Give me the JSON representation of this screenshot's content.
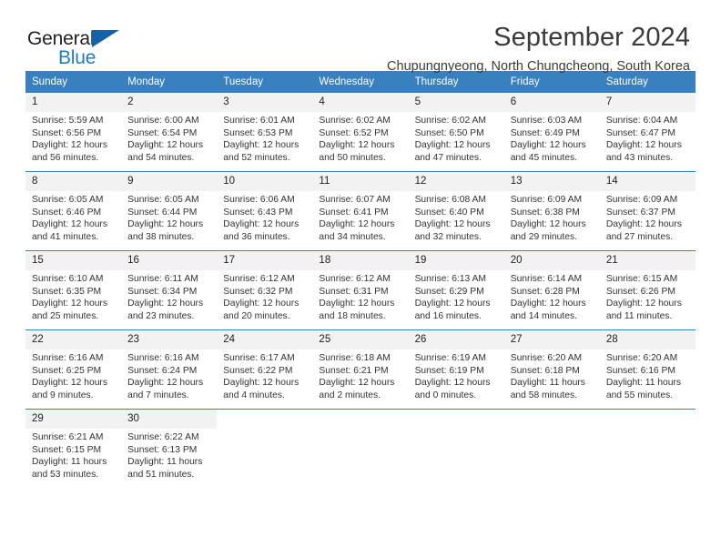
{
  "brand": {
    "name_part1": "General",
    "name_part2": "Blue",
    "triangle_color": "#1463a8",
    "blue_color": "#1f7ac4"
  },
  "header": {
    "title": "September 2024",
    "subtitle": "Chupungnyeong, North Chungcheong, South Korea"
  },
  "theme": {
    "header_bg": "#3980bf",
    "day_band_bg": "#f2f2f2",
    "row_border": "#3980bf"
  },
  "weekdays": [
    "Sunday",
    "Monday",
    "Tuesday",
    "Wednesday",
    "Thursday",
    "Friday",
    "Saturday"
  ],
  "weeks": [
    [
      {
        "day": "1",
        "sunrise": "Sunrise: 5:59 AM",
        "sunset": "Sunset: 6:56 PM",
        "daylight1": "Daylight: 12 hours",
        "daylight2": "and 56 minutes."
      },
      {
        "day": "2",
        "sunrise": "Sunrise: 6:00 AM",
        "sunset": "Sunset: 6:54 PM",
        "daylight1": "Daylight: 12 hours",
        "daylight2": "and 54 minutes."
      },
      {
        "day": "3",
        "sunrise": "Sunrise: 6:01 AM",
        "sunset": "Sunset: 6:53 PM",
        "daylight1": "Daylight: 12 hours",
        "daylight2": "and 52 minutes."
      },
      {
        "day": "4",
        "sunrise": "Sunrise: 6:02 AM",
        "sunset": "Sunset: 6:52 PM",
        "daylight1": "Daylight: 12 hours",
        "daylight2": "and 50 minutes."
      },
      {
        "day": "5",
        "sunrise": "Sunrise: 6:02 AM",
        "sunset": "Sunset: 6:50 PM",
        "daylight1": "Daylight: 12 hours",
        "daylight2": "and 47 minutes."
      },
      {
        "day": "6",
        "sunrise": "Sunrise: 6:03 AM",
        "sunset": "Sunset: 6:49 PM",
        "daylight1": "Daylight: 12 hours",
        "daylight2": "and 45 minutes."
      },
      {
        "day": "7",
        "sunrise": "Sunrise: 6:04 AM",
        "sunset": "Sunset: 6:47 PM",
        "daylight1": "Daylight: 12 hours",
        "daylight2": "and 43 minutes."
      }
    ],
    [
      {
        "day": "8",
        "sunrise": "Sunrise: 6:05 AM",
        "sunset": "Sunset: 6:46 PM",
        "daylight1": "Daylight: 12 hours",
        "daylight2": "and 41 minutes."
      },
      {
        "day": "9",
        "sunrise": "Sunrise: 6:05 AM",
        "sunset": "Sunset: 6:44 PM",
        "daylight1": "Daylight: 12 hours",
        "daylight2": "and 38 minutes."
      },
      {
        "day": "10",
        "sunrise": "Sunrise: 6:06 AM",
        "sunset": "Sunset: 6:43 PM",
        "daylight1": "Daylight: 12 hours",
        "daylight2": "and 36 minutes."
      },
      {
        "day": "11",
        "sunrise": "Sunrise: 6:07 AM",
        "sunset": "Sunset: 6:41 PM",
        "daylight1": "Daylight: 12 hours",
        "daylight2": "and 34 minutes."
      },
      {
        "day": "12",
        "sunrise": "Sunrise: 6:08 AM",
        "sunset": "Sunset: 6:40 PM",
        "daylight1": "Daylight: 12 hours",
        "daylight2": "and 32 minutes."
      },
      {
        "day": "13",
        "sunrise": "Sunrise: 6:09 AM",
        "sunset": "Sunset: 6:38 PM",
        "daylight1": "Daylight: 12 hours",
        "daylight2": "and 29 minutes."
      },
      {
        "day": "14",
        "sunrise": "Sunrise: 6:09 AM",
        "sunset": "Sunset: 6:37 PM",
        "daylight1": "Daylight: 12 hours",
        "daylight2": "and 27 minutes."
      }
    ],
    [
      {
        "day": "15",
        "sunrise": "Sunrise: 6:10 AM",
        "sunset": "Sunset: 6:35 PM",
        "daylight1": "Daylight: 12 hours",
        "daylight2": "and 25 minutes."
      },
      {
        "day": "16",
        "sunrise": "Sunrise: 6:11 AM",
        "sunset": "Sunset: 6:34 PM",
        "daylight1": "Daylight: 12 hours",
        "daylight2": "and 23 minutes."
      },
      {
        "day": "17",
        "sunrise": "Sunrise: 6:12 AM",
        "sunset": "Sunset: 6:32 PM",
        "daylight1": "Daylight: 12 hours",
        "daylight2": "and 20 minutes."
      },
      {
        "day": "18",
        "sunrise": "Sunrise: 6:12 AM",
        "sunset": "Sunset: 6:31 PM",
        "daylight1": "Daylight: 12 hours",
        "daylight2": "and 18 minutes."
      },
      {
        "day": "19",
        "sunrise": "Sunrise: 6:13 AM",
        "sunset": "Sunset: 6:29 PM",
        "daylight1": "Daylight: 12 hours",
        "daylight2": "and 16 minutes."
      },
      {
        "day": "20",
        "sunrise": "Sunrise: 6:14 AM",
        "sunset": "Sunset: 6:28 PM",
        "daylight1": "Daylight: 12 hours",
        "daylight2": "and 14 minutes."
      },
      {
        "day": "21",
        "sunrise": "Sunrise: 6:15 AM",
        "sunset": "Sunset: 6:26 PM",
        "daylight1": "Daylight: 12 hours",
        "daylight2": "and 11 minutes."
      }
    ],
    [
      {
        "day": "22",
        "sunrise": "Sunrise: 6:16 AM",
        "sunset": "Sunset: 6:25 PM",
        "daylight1": "Daylight: 12 hours",
        "daylight2": "and 9 minutes."
      },
      {
        "day": "23",
        "sunrise": "Sunrise: 6:16 AM",
        "sunset": "Sunset: 6:24 PM",
        "daylight1": "Daylight: 12 hours",
        "daylight2": "and 7 minutes."
      },
      {
        "day": "24",
        "sunrise": "Sunrise: 6:17 AM",
        "sunset": "Sunset: 6:22 PM",
        "daylight1": "Daylight: 12 hours",
        "daylight2": "and 4 minutes."
      },
      {
        "day": "25",
        "sunrise": "Sunrise: 6:18 AM",
        "sunset": "Sunset: 6:21 PM",
        "daylight1": "Daylight: 12 hours",
        "daylight2": "and 2 minutes."
      },
      {
        "day": "26",
        "sunrise": "Sunrise: 6:19 AM",
        "sunset": "Sunset: 6:19 PM",
        "daylight1": "Daylight: 12 hours",
        "daylight2": "and 0 minutes."
      },
      {
        "day": "27",
        "sunrise": "Sunrise: 6:20 AM",
        "sunset": "Sunset: 6:18 PM",
        "daylight1": "Daylight: 11 hours",
        "daylight2": "and 58 minutes."
      },
      {
        "day": "28",
        "sunrise": "Sunrise: 6:20 AM",
        "sunset": "Sunset: 6:16 PM",
        "daylight1": "Daylight: 11 hours",
        "daylight2": "and 55 minutes."
      }
    ],
    [
      {
        "day": "29",
        "sunrise": "Sunrise: 6:21 AM",
        "sunset": "Sunset: 6:15 PM",
        "daylight1": "Daylight: 11 hours",
        "daylight2": "and 53 minutes."
      },
      {
        "day": "30",
        "sunrise": "Sunrise: 6:22 AM",
        "sunset": "Sunset: 6:13 PM",
        "daylight1": "Daylight: 11 hours",
        "daylight2": "and 51 minutes."
      },
      {
        "day": "",
        "sunrise": "",
        "sunset": "",
        "daylight1": "",
        "daylight2": ""
      },
      {
        "day": "",
        "sunrise": "",
        "sunset": "",
        "daylight1": "",
        "daylight2": ""
      },
      {
        "day": "",
        "sunrise": "",
        "sunset": "",
        "daylight1": "",
        "daylight2": ""
      },
      {
        "day": "",
        "sunrise": "",
        "sunset": "",
        "daylight1": "",
        "daylight2": ""
      },
      {
        "day": "",
        "sunrise": "",
        "sunset": "",
        "daylight1": "",
        "daylight2": ""
      }
    ]
  ]
}
